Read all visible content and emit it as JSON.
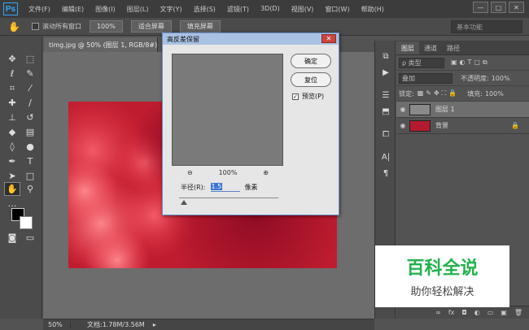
{
  "app": {
    "logo": "Ps"
  },
  "menu": [
    "文件(F)",
    "编辑(E)",
    "图像(I)",
    "图层(L)",
    "文字(Y)",
    "选择(S)",
    "滤镜(T)",
    "3D(D)",
    "视图(V)",
    "窗口(W)",
    "帮助(H)"
  ],
  "window_buttons": {
    "minimize": "—",
    "restore": "□",
    "close": "✕"
  },
  "options": {
    "scroll_all_label": "滚动所有窗口",
    "zoom_100": "100%",
    "fit_screen": "适合屏幕",
    "fill_screen": "填充屏幕",
    "workspace": "基本功能"
  },
  "document": {
    "tab": "timg.jpg @ 50% (图层 1, RGB/8#) *",
    "tab_close": "×"
  },
  "status": {
    "zoom": "50%",
    "docinfo": "文档:1.78M/3.56M",
    "arrow": "▸"
  },
  "dialog": {
    "title": "高反差保留",
    "ok": "确定",
    "reset": "复位",
    "preview_label": "预览(P)",
    "preview_checked": true,
    "zoom_out": "⊖",
    "zoom_level": "100%",
    "zoom_in": "⊕",
    "radius_label": "半径(R):",
    "radius_value": "1.5",
    "radius_unit": "像素",
    "slider_fraction": 0.02
  },
  "panel": {
    "tabs": [
      "图层",
      "通道",
      "路径"
    ],
    "kind_label": "ρ 类型",
    "blend_mode": "叠加",
    "opacity_label": "不透明度:",
    "opacity_value": "100%",
    "lock_label": "锁定:",
    "fill_label": "填充:",
    "fill_value": "100%",
    "layers": [
      {
        "name": "图层 1",
        "selected": true,
        "locked": false
      },
      {
        "name": "背景",
        "selected": false,
        "locked": true
      }
    ],
    "lock_icon": "🔒",
    "bottom_icons": [
      "∞",
      "fx",
      "◘",
      "◐",
      "▭",
      "▣",
      "🗑"
    ]
  },
  "watermark": {
    "line1": "百科全说",
    "line2": "助你轻松解决",
    "color": "#22b14c"
  }
}
